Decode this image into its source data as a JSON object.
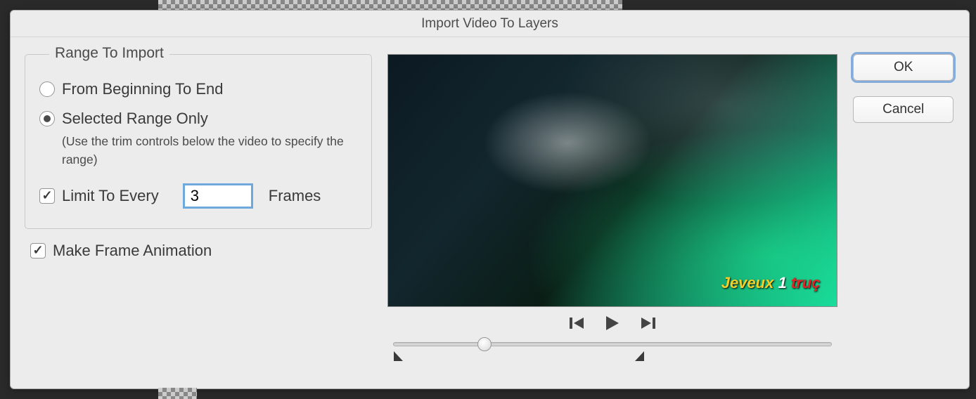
{
  "dialog": {
    "title": "Import Video To Layers"
  },
  "range": {
    "legend": "Range To Import",
    "from_beginning": "From Beginning To End",
    "selected_only": "Selected Range Only",
    "hint": "(Use the trim controls below the video to specify the range)",
    "limit_label": "Limit To Every",
    "limit_value": "3",
    "limit_suffix": "Frames"
  },
  "make_anim": {
    "label": "Make Frame Animation"
  },
  "subtitle": {
    "w1": "Jeveux",
    "w2": "1",
    "w3": "truç"
  },
  "buttons": {
    "ok": "OK",
    "cancel": "Cancel"
  }
}
